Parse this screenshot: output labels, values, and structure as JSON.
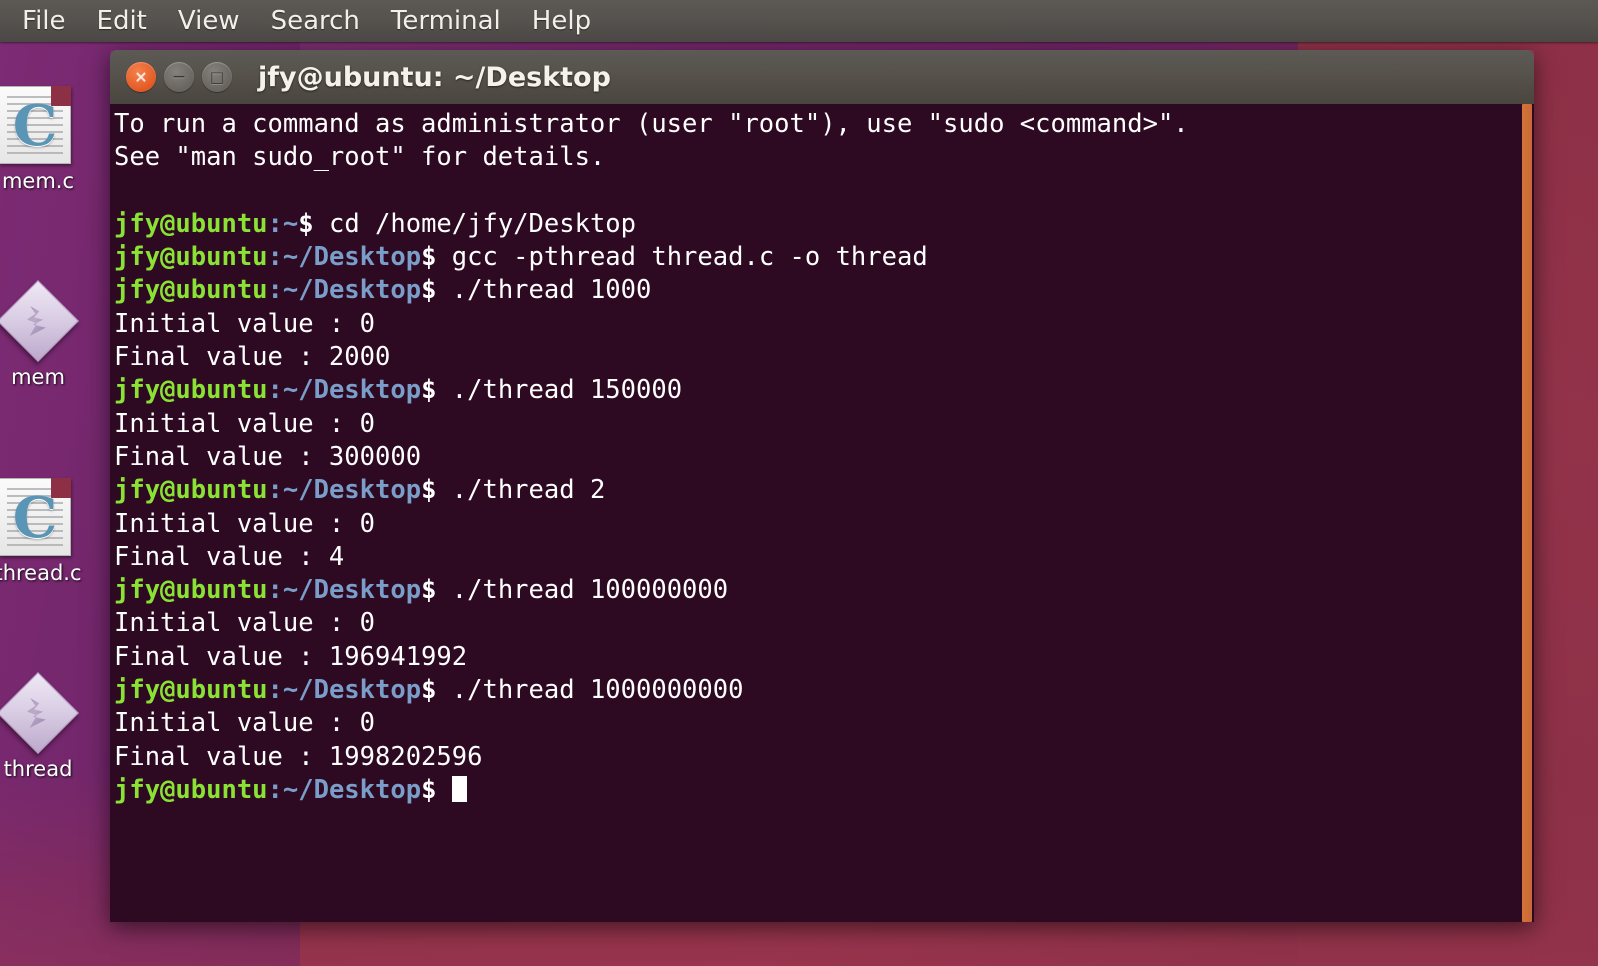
{
  "menubar": {
    "items": [
      {
        "label": "File",
        "name": "menu-file"
      },
      {
        "label": "Edit",
        "name": "menu-edit"
      },
      {
        "label": "View",
        "name": "menu-view"
      },
      {
        "label": "Search",
        "name": "menu-search"
      },
      {
        "label": "Terminal",
        "name": "menu-terminal"
      },
      {
        "label": "Help",
        "name": "menu-help"
      }
    ]
  },
  "desktop": {
    "icons": [
      {
        "label": "mem.c",
        "type": "c-source-file",
        "icon": "c-file-icon"
      },
      {
        "label": "mem",
        "type": "executable",
        "icon": "executable-icon"
      },
      {
        "label": "thread.c",
        "type": "c-source-file",
        "icon": "c-file-icon"
      },
      {
        "label": "thread",
        "type": "executable",
        "icon": "executable-icon"
      }
    ]
  },
  "window": {
    "title": "jfy@ubuntu: ~/Desktop",
    "buttons": {
      "close": "×",
      "minimize": "−",
      "maximize": "□"
    }
  },
  "terminal": {
    "prompt_user": "jfy@ubuntu",
    "prompt_home": ":~",
    "prompt_desktop": ":~/Desktop",
    "prompt_symbol": "$",
    "colors": {
      "background": "#2d0a22",
      "foreground": "#ffffff",
      "user": "#8ae234",
      "path": "#7a9ec9",
      "scrollbar": "#d4723a"
    },
    "lines": [
      {
        "type": "out",
        "text": "To run a command as administrator (user \"root\"), use \"sudo <command>\"."
      },
      {
        "type": "out",
        "text": "See \"man sudo_root\" for details."
      },
      {
        "type": "out",
        "text": ""
      },
      {
        "type": "prompt",
        "host": "jfy@ubuntu",
        "path": ":~",
        "sym": "$",
        "cmd": " cd /home/jfy/Desktop"
      },
      {
        "type": "prompt",
        "host": "jfy@ubuntu",
        "path": ":~/Desktop",
        "sym": "$",
        "cmd": " gcc -pthread thread.c -o thread"
      },
      {
        "type": "prompt",
        "host": "jfy@ubuntu",
        "path": ":~/Desktop",
        "sym": "$",
        "cmd": " ./thread 1000"
      },
      {
        "type": "out",
        "text": "Initial value : 0"
      },
      {
        "type": "out",
        "text": "Final value : 2000"
      },
      {
        "type": "prompt",
        "host": "jfy@ubuntu",
        "path": ":~/Desktop",
        "sym": "$",
        "cmd": " ./thread 150000"
      },
      {
        "type": "out",
        "text": "Initial value : 0"
      },
      {
        "type": "out",
        "text": "Final value : 300000"
      },
      {
        "type": "prompt",
        "host": "jfy@ubuntu",
        "path": ":~/Desktop",
        "sym": "$",
        "cmd": " ./thread 2"
      },
      {
        "type": "out",
        "text": "Initial value : 0"
      },
      {
        "type": "out",
        "text": "Final value : 4"
      },
      {
        "type": "prompt",
        "host": "jfy@ubuntu",
        "path": ":~/Desktop",
        "sym": "$",
        "cmd": " ./thread 100000000"
      },
      {
        "type": "out",
        "text": "Initial value : 0"
      },
      {
        "type": "out",
        "text": "Final value : 196941992"
      },
      {
        "type": "prompt",
        "host": "jfy@ubuntu",
        "path": ":~/Desktop",
        "sym": "$",
        "cmd": " ./thread 1000000000"
      },
      {
        "type": "out",
        "text": "Initial value : 0"
      },
      {
        "type": "out",
        "text": "Final value : 1998202596"
      },
      {
        "type": "prompt",
        "host": "jfy@ubuntu",
        "path": ":~/Desktop",
        "sym": "$",
        "cmd": " ",
        "cursor": true
      }
    ]
  }
}
